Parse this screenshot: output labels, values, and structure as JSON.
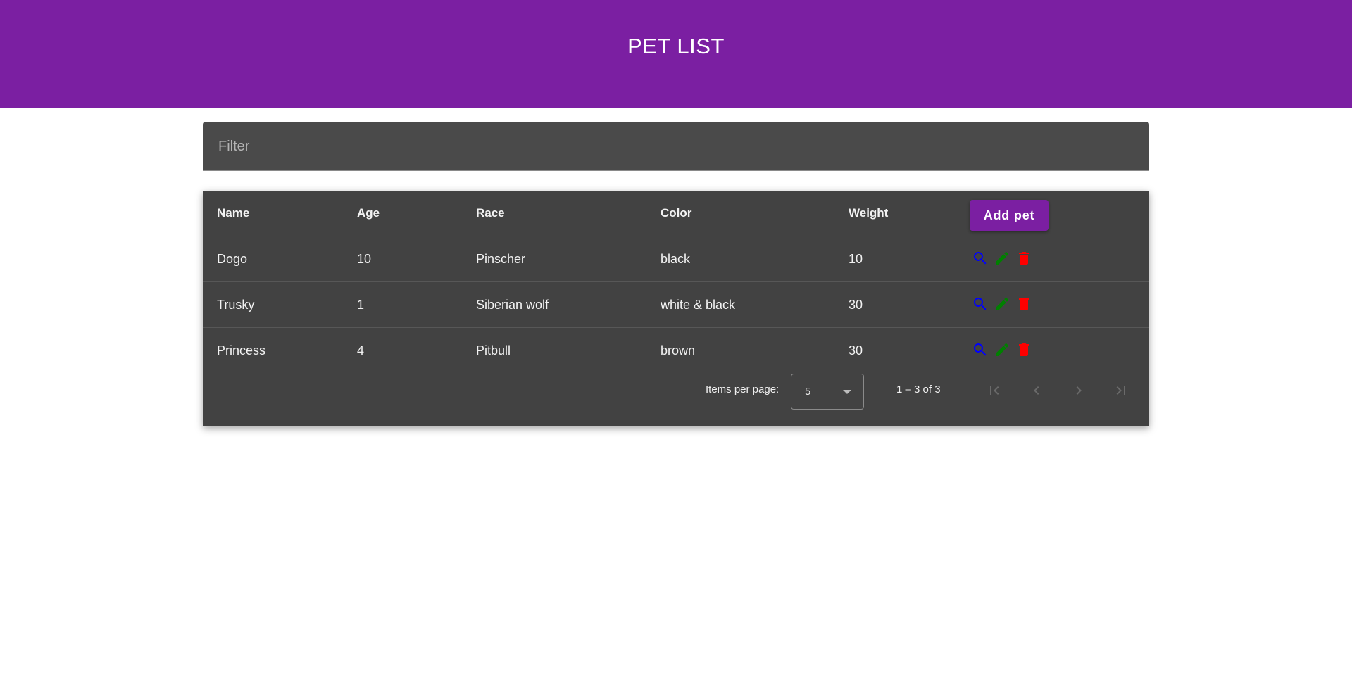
{
  "header": {
    "title": "PET LIST",
    "background": "#7b1fa2"
  },
  "filter": {
    "placeholder": "Filter",
    "value": ""
  },
  "table": {
    "columns": {
      "name": "Name",
      "age": "Age",
      "race": "Race",
      "color": "Color",
      "weight": "Weight"
    },
    "add_button_label": "Add pet",
    "rows": [
      {
        "name": "Dogo",
        "age": "10",
        "race": "Pinscher",
        "color": "black",
        "weight": "10"
      },
      {
        "name": "Trusky",
        "age": "1",
        "race": "Siberian wolf",
        "color": "white & black",
        "weight": "30"
      },
      {
        "name": "Princess",
        "age": "4",
        "race": "Pitbull",
        "color": "brown",
        "weight": "30"
      }
    ],
    "row_actions": [
      {
        "icon": "search-icon",
        "color": "#0000ff"
      },
      {
        "icon": "pencil-icon",
        "color": "#008000"
      },
      {
        "icon": "trash-icon",
        "color": "#ff0000"
      }
    ]
  },
  "paginator": {
    "items_per_page_label": "Items per page:",
    "items_per_page_value": "5",
    "range_label": "1 – 3 of 3",
    "buttons": [
      "first-page-icon",
      "previous-page-icon",
      "next-page-icon",
      "last-page-icon"
    ]
  }
}
